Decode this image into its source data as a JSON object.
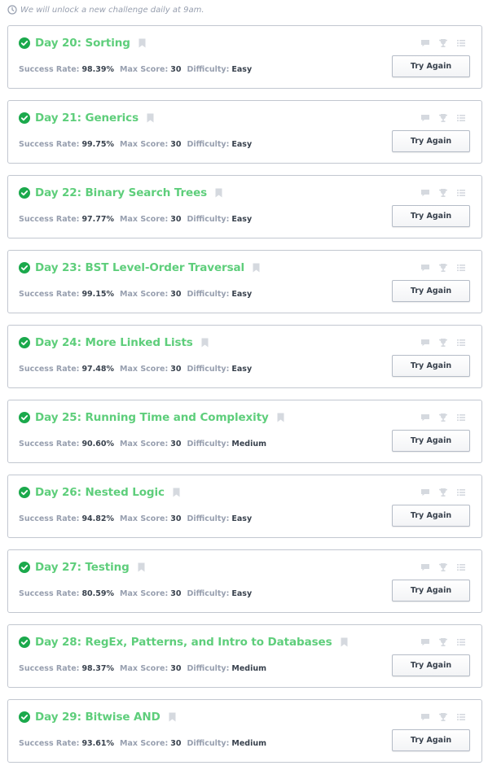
{
  "notice": {
    "text": "We will unlock a new challenge daily at 9am.",
    "icon": "clock-icon"
  },
  "labels": {
    "success_rate": "Success Rate:",
    "max_score": "Max Score:",
    "difficulty": "Difficulty:",
    "try_again": "Try Again"
  },
  "colors": {
    "solved_green": "#5ece7b",
    "muted": "#979faf",
    "text": "#39424e",
    "border": "#c2c7d0"
  },
  "challenges": [
    {
      "title": "Day 20: Sorting",
      "success_rate": "98.39%",
      "max_score": "30",
      "difficulty": "Easy"
    },
    {
      "title": "Day 21: Generics",
      "success_rate": "99.75%",
      "max_score": "30",
      "difficulty": "Easy"
    },
    {
      "title": "Day 22: Binary Search Trees",
      "success_rate": "97.77%",
      "max_score": "30",
      "difficulty": "Easy"
    },
    {
      "title": "Day 23: BST Level-Order Traversal",
      "success_rate": "99.15%",
      "max_score": "30",
      "difficulty": "Easy"
    },
    {
      "title": "Day 24: More Linked Lists",
      "success_rate": "97.48%",
      "max_score": "30",
      "difficulty": "Easy"
    },
    {
      "title": "Day 25: Running Time and Complexity",
      "success_rate": "90.60%",
      "max_score": "30",
      "difficulty": "Medium"
    },
    {
      "title": "Day 26: Nested Logic",
      "success_rate": "94.82%",
      "max_score": "30",
      "difficulty": "Easy"
    },
    {
      "title": "Day 27: Testing",
      "success_rate": "80.59%",
      "max_score": "30",
      "difficulty": "Easy"
    },
    {
      "title": "Day 28: RegEx, Patterns, and Intro to Databases",
      "success_rate": "98.37%",
      "max_score": "30",
      "difficulty": "Medium"
    },
    {
      "title": "Day 29: Bitwise AND",
      "success_rate": "93.61%",
      "max_score": "30",
      "difficulty": "Medium"
    }
  ]
}
